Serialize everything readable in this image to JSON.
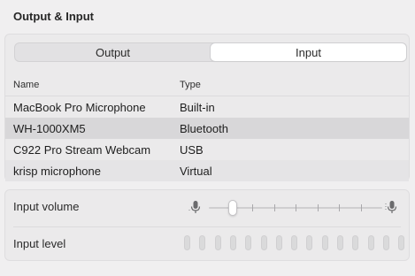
{
  "section": {
    "title": "Output & Input"
  },
  "tabs": [
    {
      "label": "Output",
      "selected": false
    },
    {
      "label": "Input",
      "selected": true
    }
  ],
  "table": {
    "columns": {
      "name": "Name",
      "type": "Type"
    },
    "rows": [
      {
        "name": "MacBook Pro Microphone",
        "type": "Built-in"
      },
      {
        "name": "WH-1000XM5",
        "type": "Bluetooth"
      },
      {
        "name": "C922 Pro Stream Webcam",
        "type": "USB"
      },
      {
        "name": "krisp microphone",
        "type": "Virtual"
      }
    ],
    "selected_index": 1
  },
  "controls": {
    "input_volume_label": "Input volume",
    "input_volume_fraction": 0.12,
    "input_level_label": "Input level",
    "input_level_bar_count": 15,
    "input_level_lit_count": 0
  },
  "icons": {
    "volume_low": "microphone-low-icon",
    "volume_high": "microphone-high-icon"
  },
  "colors": {
    "level_off": "#dadadb",
    "level_on": "#5fc15f"
  }
}
